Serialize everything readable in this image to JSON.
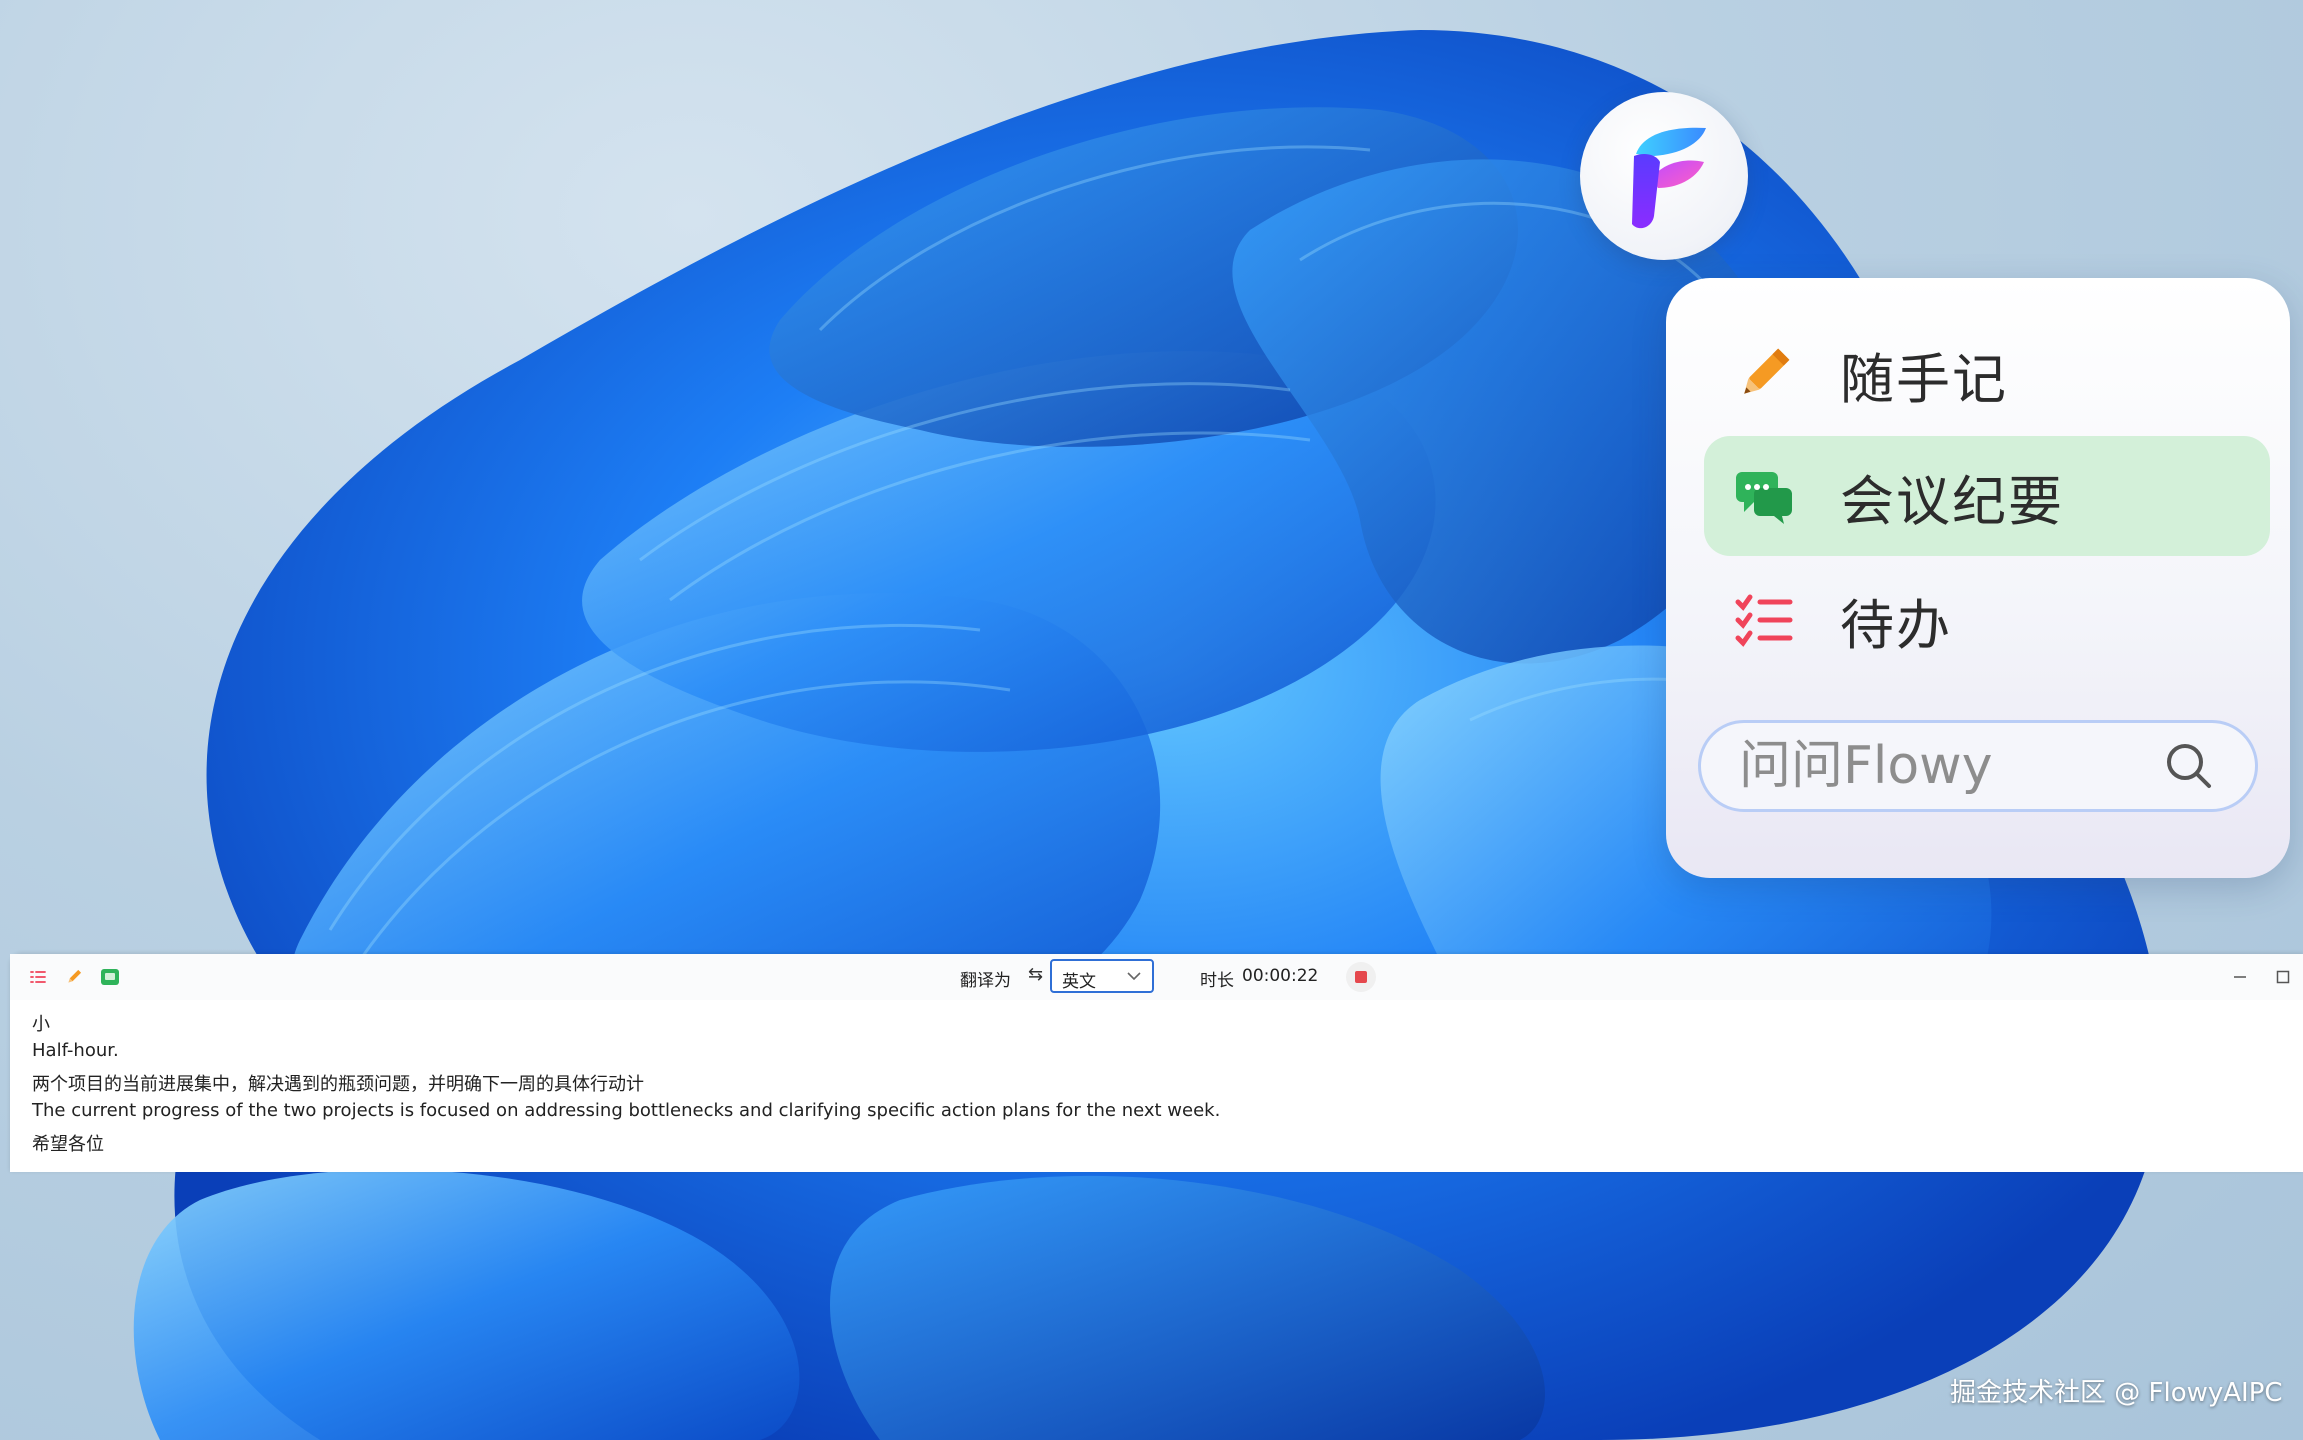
{
  "quick_menu": {
    "items": [
      {
        "label": "随手记",
        "icon": "pencil-icon"
      },
      {
        "label": "会议纪要",
        "icon": "meeting-chat-icon",
        "active": true
      },
      {
        "label": "待办",
        "icon": "todo-list-icon"
      }
    ],
    "ask_placeholder": "问问Flowy"
  },
  "meeting_bar": {
    "translate_label": "翻译为",
    "swap_icon": "⇆",
    "language": "英文",
    "duration_label": "时长",
    "duration_value": "00:00:22",
    "transcript": [
      {
        "source": "小",
        "translation": "Half-hour."
      },
      {
        "source": "两个项目的当前进展集中，解决遇到的瓶颈问题，并明确下一周的具体行动计",
        "translation": "The current progress of the two projects is focused on addressing bottlenecks and clarifying specific action plans for the next week."
      },
      {
        "source": "希望各位",
        "translation": ""
      }
    ]
  },
  "watermark": "掘金技术社区 @ FlowyAIPC",
  "colors": {
    "accent": "#2f6fd6",
    "active_item_bg": "#d3f0d9",
    "stop_red": "#e5484d",
    "pencil_orange": "#f59a23",
    "todo_red": "#f0445a",
    "meeting_green": "#2fb35a"
  }
}
